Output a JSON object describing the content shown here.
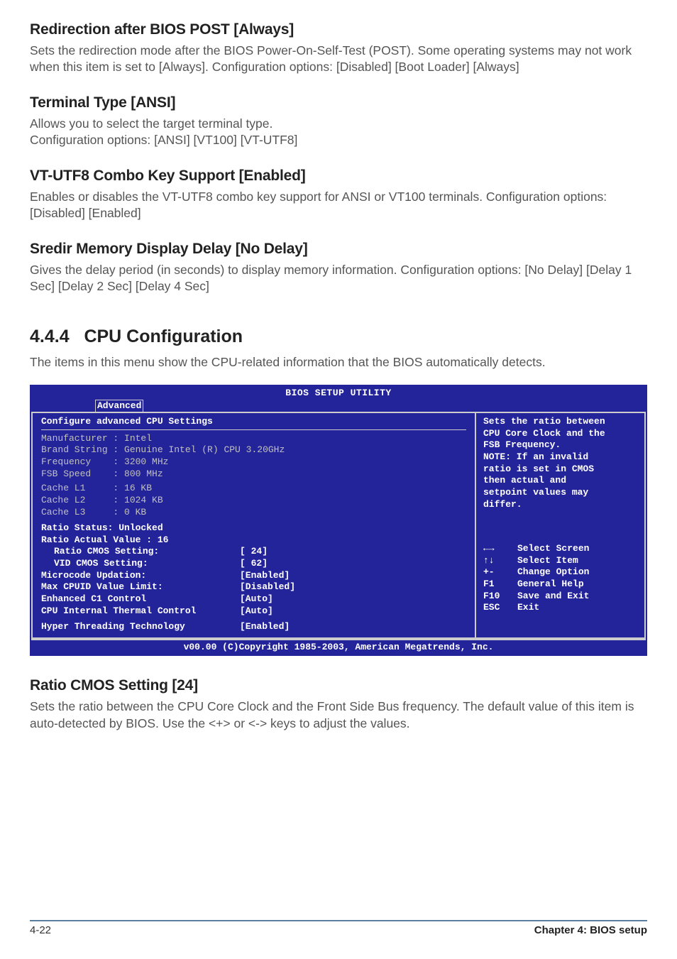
{
  "sections": {
    "redir": {
      "heading": "Redirection after BIOS POST [Always]",
      "text": "Sets the redirection mode after the BIOS Power-On-Self-Test (POST). Some operating systems may not work when this item is set to [Always]. Configuration options: [Disabled] [Boot Loader] [Always]"
    },
    "term": {
      "heading": "Terminal Type [ANSI]",
      "text": "Allows you to select the target terminal type.\nConfiguration options: [ANSI] [VT100] [VT-UTF8]"
    },
    "vtutf8": {
      "heading": "VT-UTF8 Combo Key Support [Enabled]",
      "text": "Enables or disables the VT-UTF8 combo key support for ANSI or VT100 terminals. Configuration options: [Disabled] [Enabled]"
    },
    "sredir": {
      "heading": "Sredir Memory Display Delay [No Delay]",
      "text": "Gives the delay period (in seconds) to display memory information. Configuration options: [No Delay] [Delay 1 Sec] [Delay 2 Sec] [Delay 4 Sec]"
    },
    "section_number": "4.4.4",
    "section_title": "CPU Configuration",
    "section_intro": "The items in this menu show the CPU-related information that the BIOS automatically detects.",
    "ratio": {
      "heading": "Ratio CMOS Setting [24]",
      "text": "Sets the ratio between the CPU Core Clock and the Front Side Bus frequency. The default value of this item is auto-detected by BIOS. Use the <+> or <-> keys to adjust the values."
    }
  },
  "bios": {
    "title": "BIOS SETUP UTILITY",
    "tab_active": "Advanced",
    "panel_title": "Configure advanced CPU Settings",
    "info": {
      "manufacturer_label": "Manufacturer : ",
      "manufacturer": "Intel",
      "brand_label": "Brand String : ",
      "brand": "Genuine Intel (R) CPU 3.20GHz",
      "freq_label": "Frequency    : ",
      "freq": "3200 MHz",
      "fsb_label": "FSB Speed    : ",
      "fsb": "800 MHz",
      "l1_label": "Cache L1     : ",
      "l1": "16 KB",
      "l2_label": "Cache L2     : ",
      "l2": "1024 KB",
      "l3_label": "Cache L3     : ",
      "l3": "0 KB",
      "ratio_status_label": "Ratio Status: ",
      "ratio_status": "Unlocked",
      "ratio_actual_label": "Ratio Actual Value : ",
      "ratio_actual": "16"
    },
    "opts": {
      "ratio_cmos": {
        "label": "Ratio CMOS Setting:",
        "val": "[ 24]"
      },
      "vid_cmos": {
        "label": "VID CMOS Setting:",
        "val": "[ 62]"
      },
      "microcode": {
        "label": "Microcode Updation:",
        "val": "[Enabled]"
      },
      "max_cpuid": {
        "label": "Max CPUID Value Limit:",
        "val": "[Disabled]"
      },
      "enh_c1": {
        "label": "Enhanced C1 Control",
        "val": "[Auto]"
      },
      "thermal": {
        "label": "CPU Internal Thermal Control",
        "val": "[Auto]"
      },
      "hyperthread": {
        "label": "Hyper Threading Technology",
        "val": "[Enabled]"
      }
    },
    "help": {
      "l1": "Sets the ratio between",
      "l2": "CPU Core Clock and the",
      "l3": "FSB Frequency.",
      "l4": "NOTE: If an invalid",
      "l5": "ratio is set in CMOS",
      "l6": "then actual and",
      "l7": "setpoint values may",
      "l8": "differ."
    },
    "nav": {
      "n1": {
        "key": "←→",
        "label": "Select Screen"
      },
      "n2": {
        "key": "↑↓",
        "label": "Select Item"
      },
      "n3": {
        "key": "+-",
        "label": "Change Option"
      },
      "n4": {
        "key": "F1",
        "label": "General Help"
      },
      "n5": {
        "key": "F10",
        "label": "Save and Exit"
      },
      "n6": {
        "key": "ESC",
        "label": "Exit"
      }
    },
    "copyright": "v00.00 (C)Copyright 1985-2003, American Megatrends, Inc."
  },
  "footer": {
    "page": "4-22",
    "chapter": "Chapter 4: BIOS setup"
  }
}
